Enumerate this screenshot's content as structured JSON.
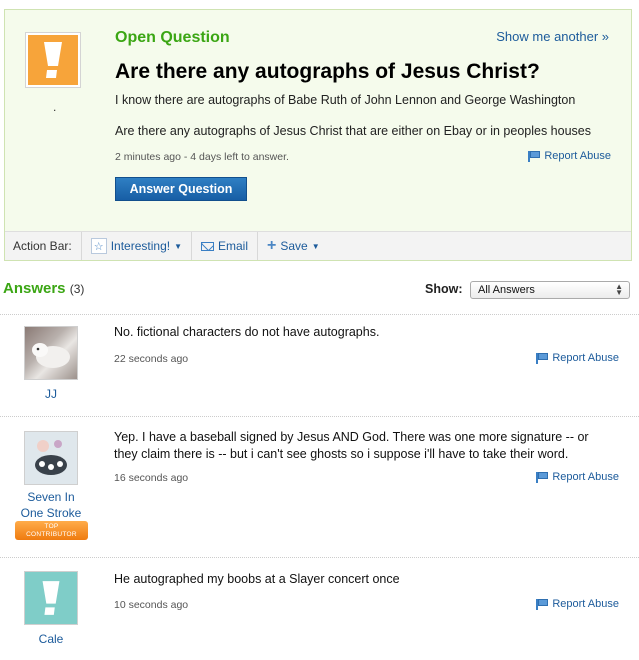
{
  "question": {
    "status_label": "Open Question",
    "show_another": "Show me another »",
    "title": "Are there any autographs of Jesus Christ?",
    "body_line1": "I know there are autographs of Babe Ruth of John Lennon and George Washington",
    "body_line2": "Are there any autographs of Jesus Christ that are either on Ebay or in peoples houses",
    "meta": "2 minutes ago - 4 days left to answer.",
    "report_label": "Report Abuse",
    "answer_button": "Answer Question",
    "asker_name": ".",
    "avatar_color": "#f7a43a"
  },
  "action_bar": {
    "label": "Action Bar:",
    "interesting": "Interesting!",
    "email": "Email",
    "save": "Save"
  },
  "answers_header": {
    "title": "Answers",
    "count": "(3)",
    "show_label": "Show:",
    "filter_value": "All Answers"
  },
  "answers": [
    {
      "user": "JJ",
      "text": "No. fictional characters do not have autographs.",
      "time": "22 seconds ago",
      "report": "Report Abuse"
    },
    {
      "user_line1": "Seven In",
      "user_line2": "One Stroke",
      "badge_line1": "TOP",
      "badge_line2": "CONTRIBUTOR",
      "text_line1": "Yep. I have a baseball signed by Jesus AND God. There was one more signature -- or",
      "text_line2": "they claim there is -- but i can't see ghosts so i suppose i'll have to take their word.",
      "time": "16 seconds ago",
      "report": "Report Abuse"
    },
    {
      "user": "Cale",
      "text": "He autographed my boobs at a Slayer concert once",
      "time": "10 seconds ago",
      "report": "Report Abuse",
      "avatar_color": "#7fcdc8"
    }
  ],
  "colors": {
    "accent_green": "#3ba614",
    "link_blue": "#1c5b9b",
    "button_blue": "#175ea5",
    "badge_orange": "#ef7b0f"
  }
}
